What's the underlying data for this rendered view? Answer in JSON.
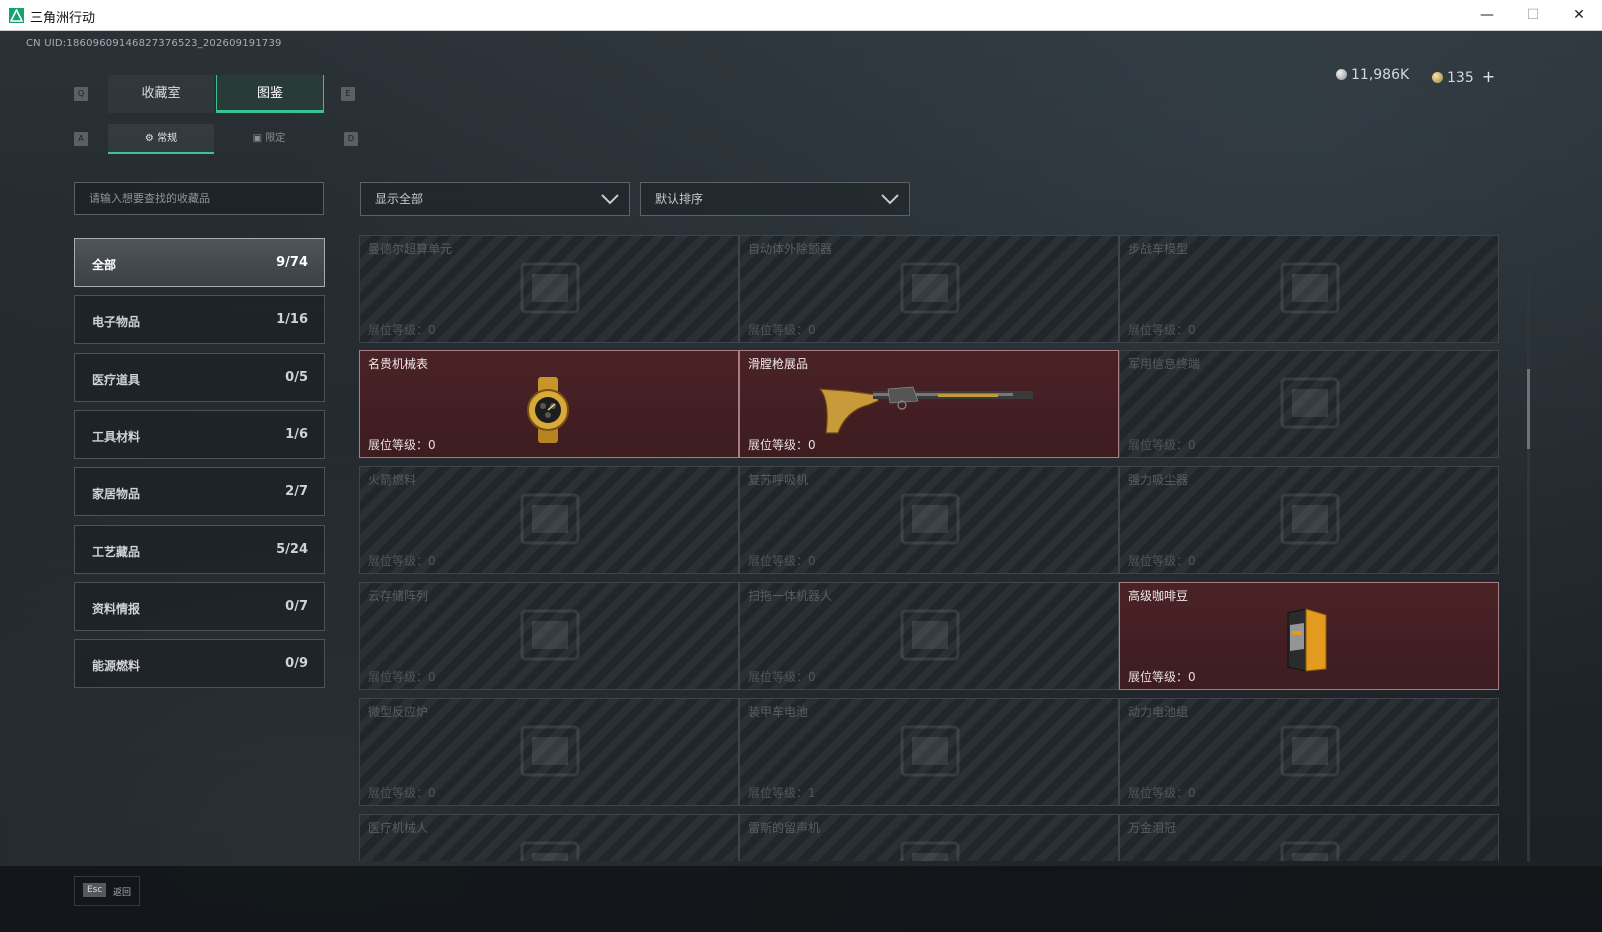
{
  "window": {
    "title": "三角洲行动"
  },
  "uid": "CN UID:18609609146827376523_202609191739",
  "currency": {
    "silver": "11,986K",
    "gold": "135",
    "add": "+"
  },
  "tabs": {
    "main": [
      {
        "label": "收藏室",
        "key": "Q"
      },
      {
        "label": "图鉴",
        "key": "E"
      }
    ],
    "sub": [
      {
        "label": "常规",
        "key": "A"
      },
      {
        "label": "限定",
        "key": "D"
      }
    ]
  },
  "search": {
    "placeholder": "请输入想要查找的收藏品"
  },
  "filters": {
    "show": "显示全部",
    "sort": "默认排序"
  },
  "categories": [
    {
      "label": "全部",
      "count": "9/74"
    },
    {
      "label": "电子物品",
      "count": "1/16"
    },
    {
      "label": "医疗道具",
      "count": "0/5"
    },
    {
      "label": "工具材料",
      "count": "1/6"
    },
    {
      "label": "家居物品",
      "count": "2/7"
    },
    {
      "label": "工艺藏品",
      "count": "5/24"
    },
    {
      "label": "资料情报",
      "count": "0/7"
    },
    {
      "label": "能源燃料",
      "count": "0/9"
    }
  ],
  "level_label": "展位等级：",
  "items": [
    {
      "name": "曼德尔超算单元",
      "level": "0",
      "owned": false
    },
    {
      "name": "自动体外除颤器",
      "level": "0",
      "owned": false
    },
    {
      "name": "步战车模型",
      "level": "0",
      "owned": false
    },
    {
      "name": "名贵机械表",
      "level": "0",
      "owned": true,
      "icon": "watch-icon"
    },
    {
      "name": "滑膛枪展品",
      "level": "0",
      "owned": true,
      "icon": "musket-icon"
    },
    {
      "name": "军用信息终端",
      "level": "0",
      "owned": false
    },
    {
      "name": "火箭燃料",
      "level": "0",
      "owned": false
    },
    {
      "name": "复苏呼吸机",
      "level": "0",
      "owned": false
    },
    {
      "name": "强力吸尘器",
      "level": "0",
      "owned": false
    },
    {
      "name": "云存储阵列",
      "level": "0",
      "owned": false
    },
    {
      "name": "扫拖一体机器人",
      "level": "0",
      "owned": false
    },
    {
      "name": "高级咖啡豆",
      "level": "0",
      "owned": true,
      "icon": "coffee-bag-icon"
    },
    {
      "name": "微型反应炉",
      "level": "0",
      "owned": false
    },
    {
      "name": "装甲车电池",
      "level": "1",
      "owned": false
    },
    {
      "name": "动力电池组",
      "level": "0",
      "owned": false
    },
    {
      "name": "医疗机械人",
      "level": "",
      "owned": false
    },
    {
      "name": "雷斯的留声机",
      "level": "",
      "owned": false
    },
    {
      "name": "万金泪冠",
      "level": "",
      "owned": false
    }
  ],
  "footer": {
    "key": "Esc",
    "label": "返回"
  }
}
